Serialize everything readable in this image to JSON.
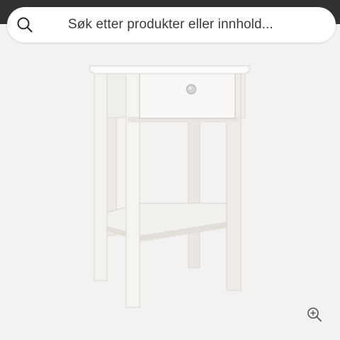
{
  "search": {
    "placeholder": "Søk etter produkter eller innhold...",
    "icon": "search-icon"
  },
  "product_image": {
    "subject": "white-bedside-table",
    "icon": "nightstand-image"
  },
  "zoom": {
    "icon": "zoom-in-icon"
  },
  "colors": {
    "top_bar": "#2f3133",
    "page_background": "#f4f2f0",
    "search_field": "#ffffff",
    "icon_stroke": "#555555"
  }
}
